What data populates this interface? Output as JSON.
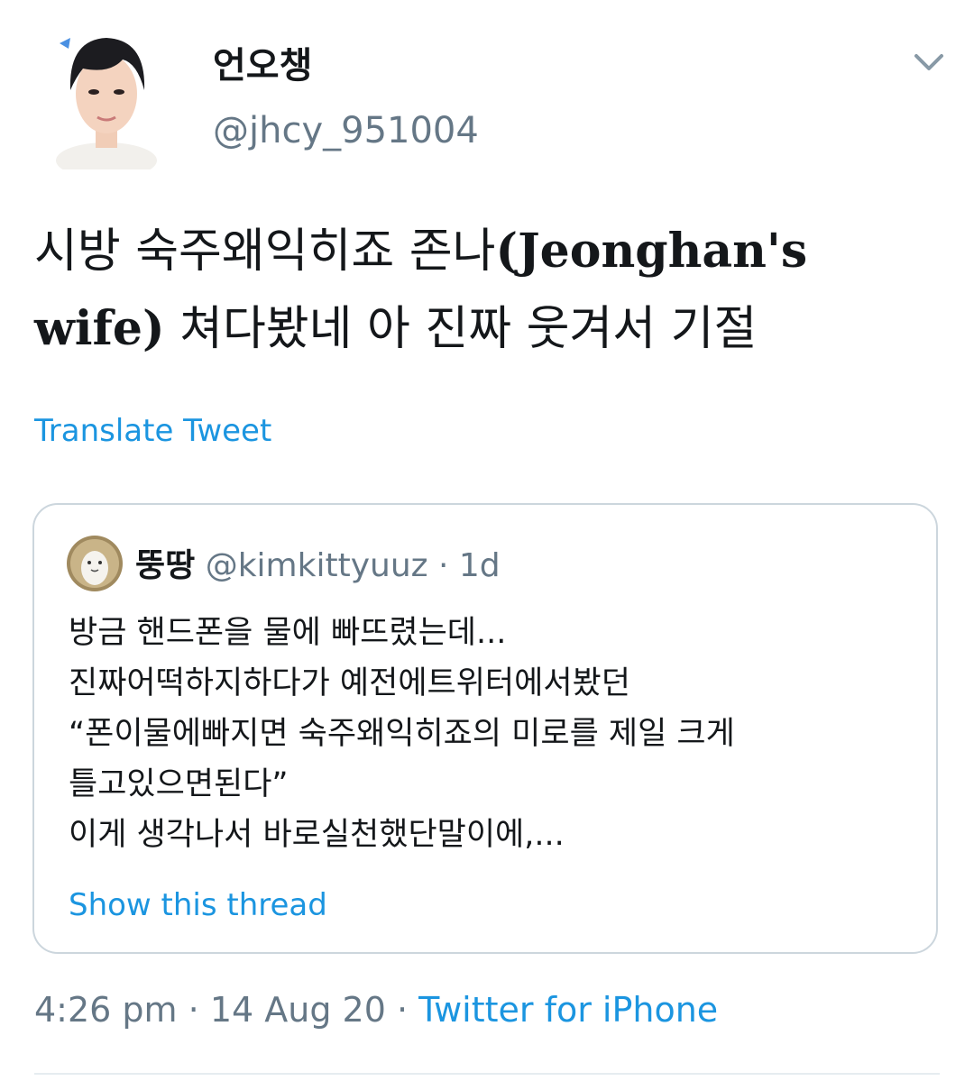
{
  "author": {
    "display_name": "언오챙",
    "handle": "@jhcy_951004"
  },
  "tweet": {
    "line1_korean": "시방 숙주왜익히죠 존나",
    "line1_latin": "(Jeonghan's",
    "line2_latin": "wife)",
    "line2_korean": " 쳐다봤네 아 진짜 웃겨서 기절",
    "translate_label": "Translate Tweet"
  },
  "quoted_tweet": {
    "display_name": "뚱땅",
    "handle": "@kimkittyuuz",
    "separator": " · ",
    "time": "1d",
    "lines": [
      "방금 핸드폰을 물에 빠뜨렸는데...",
      "진짜어떡하지하다가 예전에트위터에서봤던",
      "“폰이물에빠지면 숙주왜익히죠의 미로를 제일 크게",
      "틀고있으면된다”",
      "이게 생각나서 바로실천했단말이에,..."
    ],
    "show_thread_label": "Show this thread"
  },
  "meta": {
    "time": "4:26 pm",
    "separator": " · ",
    "date": "14 Aug 20",
    "source": "Twitter for iPhone"
  },
  "icons": {
    "more": "chevron-down-icon"
  },
  "colors": {
    "link": "#1b95e0",
    "secondary_text": "#657786",
    "border": "#ccd6dd"
  }
}
